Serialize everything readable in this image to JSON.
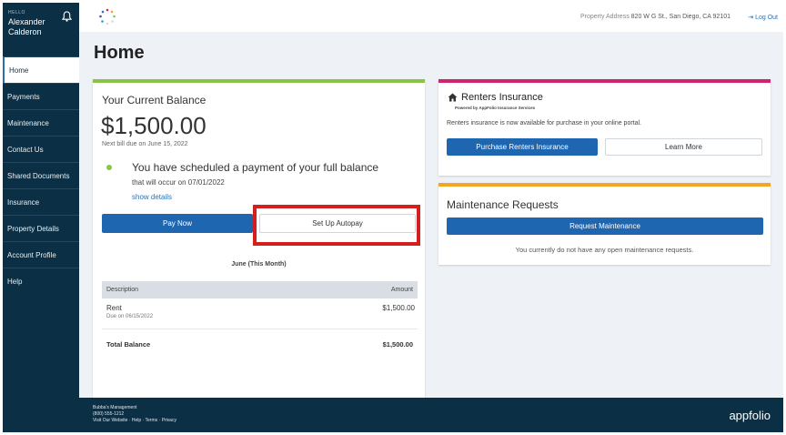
{
  "sidebar": {
    "hello": "HELLO",
    "user_name": "Alexander Calderon",
    "items": [
      {
        "label": "Home",
        "active": true
      },
      {
        "label": "Payments"
      },
      {
        "label": "Maintenance"
      },
      {
        "label": "Contact Us"
      },
      {
        "label": "Shared Documents"
      },
      {
        "label": "Insurance"
      },
      {
        "label": "Property Details"
      },
      {
        "label": "Account Profile"
      },
      {
        "label": "Help"
      }
    ]
  },
  "topbar": {
    "property_label": "Property Address",
    "property_address": "820 W G St., San Diego, CA 92101",
    "logout": "Log Out"
  },
  "page": {
    "title": "Home"
  },
  "balance": {
    "title": "Your Current Balance",
    "amount": "$1,500.00",
    "next_bill": "Next bill due on June 15, 2022",
    "scheduled_message": "You have scheduled a payment of your full balance",
    "scheduled_date": "that will occur on 07/01/2022",
    "show_details": "show details",
    "pay_now": "Pay Now",
    "setup_autopay": "Set Up Autopay",
    "month_label": "June (This Month)",
    "table": {
      "col_description": "Description",
      "col_amount": "Amount",
      "rows": [
        {
          "description": "Rent",
          "due": "Due on 06/15/2022",
          "amount": "$1,500.00"
        }
      ],
      "total_label": "Total Balance",
      "total_amount": "$1,500.00"
    }
  },
  "insurance": {
    "title": "Renters Insurance",
    "powered_by": "Powered by AppFolio Insurance Services",
    "description": "Renters insurance is now available for purchase in your online portal.",
    "purchase": "Purchase Renters Insurance",
    "learn_more": "Learn More"
  },
  "maintenance": {
    "title": "Maintenance Requests",
    "request_button": "Request Maintenance",
    "empty_message": "You currently do not have any open maintenance requests."
  },
  "footer": {
    "company": "Bubba's Management",
    "phone": "(800) 555-1212",
    "links": "Visit Our Website · Help · Terms · Privacy",
    "brand": "appfolio"
  },
  "colors": {
    "sidebar_bg": "#0b2f45",
    "primary_button": "#1f66b0",
    "balance_accent": "#8bc34a",
    "insurance_accent": "#d0246e",
    "maintenance_accent": "#f4a621",
    "highlight_box": "#d41f1f"
  }
}
